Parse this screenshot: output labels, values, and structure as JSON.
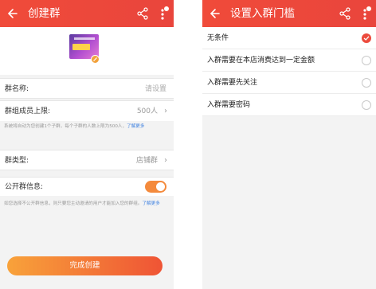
{
  "left": {
    "title": "创建群",
    "fields": {
      "name_label": "群名称:",
      "name_placeholder": "请设置",
      "limit_label": "群组成员上限:",
      "limit_value": "500人",
      "limit_note": "系统将自动为您创建1个子群，每个子群的人数上限为500人，",
      "limit_note_link": "了解更多",
      "type_label": "群类型:",
      "type_value": "店铺群",
      "public_label": "公开群信息:",
      "public_enabled": true,
      "public_note": "如您选择不公开群信息，则只要您主动邀请的用户才能加入您的群组。",
      "public_note_link": "了解更多"
    },
    "submit_label": "完成创建"
  },
  "right": {
    "title": "设置入群门槛",
    "options": [
      {
        "label": "无条件",
        "selected": true
      },
      {
        "label": "入群需要在本店消费达到一定金额",
        "selected": false
      },
      {
        "label": "入群需要先关注",
        "selected": false
      },
      {
        "label": "入群需要密码",
        "selected": false
      }
    ]
  },
  "icons": {
    "back": "back-arrow-icon",
    "share": "share-icon",
    "more": "more-vertical-icon",
    "edit": "edit-pencil-icon",
    "chevron": "chevron-right-icon",
    "check": "check-icon"
  },
  "colors": {
    "topbar": "#f04b3a",
    "accent": "#ec4b3d",
    "toggle": "#f48a3c",
    "link": "#3b7fe0"
  }
}
